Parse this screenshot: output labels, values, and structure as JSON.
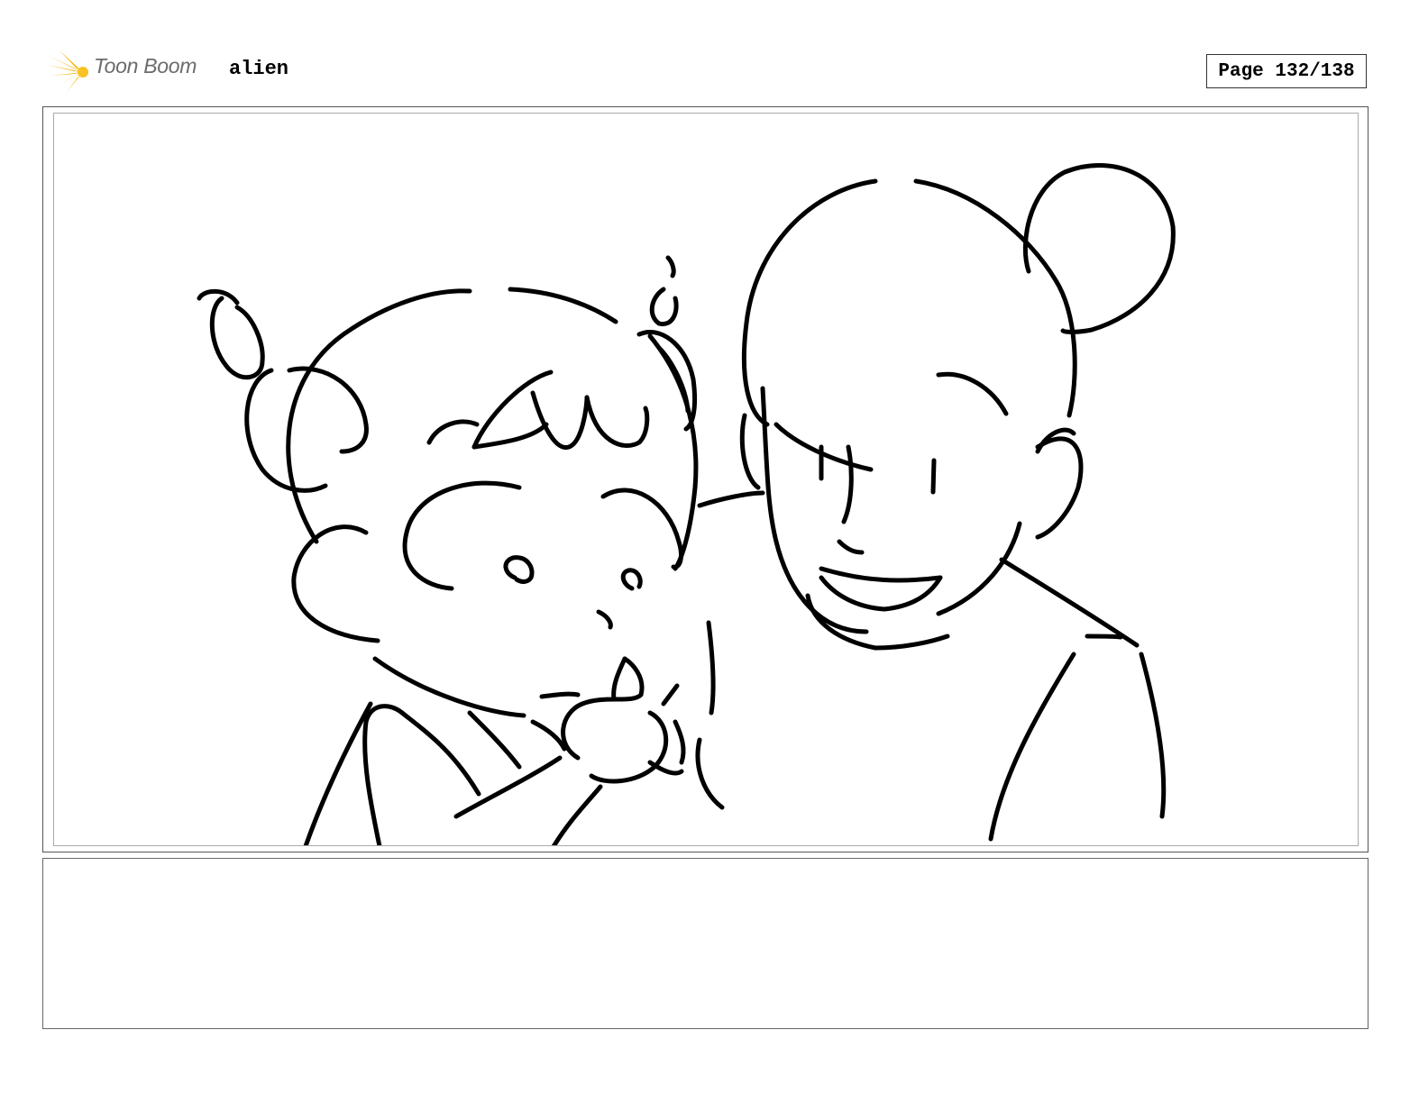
{
  "header": {
    "logo_text": "Toon Boom",
    "project_name": "alien",
    "page_label": "Page 132/138"
  },
  "panel": {
    "drawing": "storyboard-sketch"
  },
  "notes": {
    "text": ""
  }
}
